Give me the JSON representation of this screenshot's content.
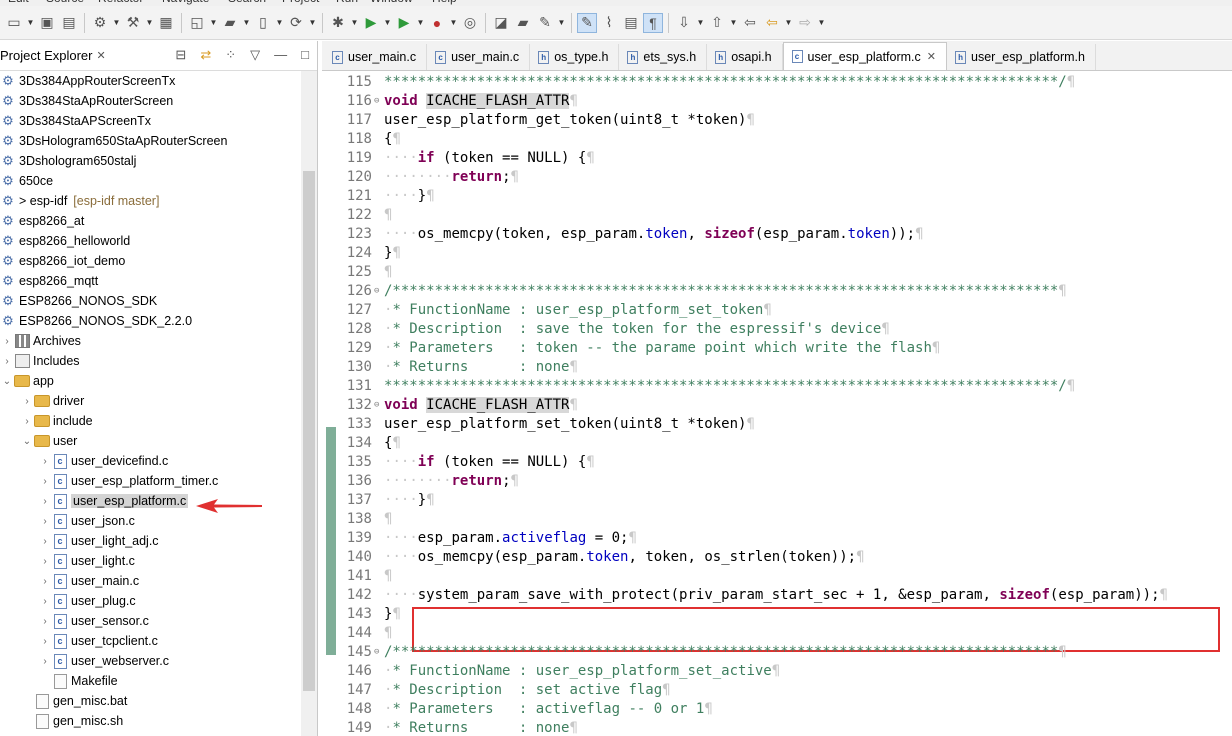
{
  "menubar": [
    "Edit",
    "Source",
    "Refactor",
    "Navigate",
    "Search",
    "Project",
    "Run",
    "Window",
    "Help"
  ],
  "explorer": {
    "title": "Project Explorer",
    "close": "✕",
    "items": [
      {
        "label": "3Ds384AppRouterScreenTx",
        "icon": "project-icon",
        "indent": 0
      },
      {
        "label": "3Ds384StaApRouterScreen",
        "icon": "project-icon",
        "indent": 0
      },
      {
        "label": "3Ds384StaAPScreenTx",
        "icon": "project-icon",
        "indent": 0
      },
      {
        "label": "3DsHologram650StaApRouterScreen",
        "icon": "project-icon",
        "indent": 0
      },
      {
        "label": "3Dshologram650stalj",
        "icon": "project-icon",
        "indent": 0
      },
      {
        "label": "650ce",
        "icon": "project-icon",
        "indent": 0
      },
      {
        "label": "> esp-idf",
        "icon": "project-icon",
        "indent": 0,
        "deco": "[esp-idf master]"
      },
      {
        "label": "esp8266_at",
        "icon": "project-icon",
        "indent": 0
      },
      {
        "label": "esp8266_helloworld",
        "icon": "project-icon",
        "indent": 0
      },
      {
        "label": "esp8266_iot_demo",
        "icon": "project-icon",
        "indent": 0
      },
      {
        "label": "esp8266_mqtt",
        "icon": "project-icon",
        "indent": 0
      },
      {
        "label": "ESP8266_NONOS_SDK",
        "icon": "project-icon",
        "indent": 0
      },
      {
        "label": "ESP8266_NONOS_SDK_2.2.0",
        "icon": "project-icon",
        "indent": 0
      },
      {
        "label": "Archives",
        "icon": "archive-icon",
        "indent": 1,
        "twisty": ">"
      },
      {
        "label": "Includes",
        "icon": "includes-icon",
        "indent": 1,
        "twisty": ">"
      },
      {
        "label": "app",
        "icon": "folder-icon",
        "indent": 1,
        "twisty": "v"
      },
      {
        "label": "driver",
        "icon": "folder-icon",
        "indent": 2,
        "twisty": ">"
      },
      {
        "label": "include",
        "icon": "folder-icon",
        "indent": 2,
        "twisty": ">"
      },
      {
        "label": "user",
        "icon": "folder-icon",
        "indent": 2,
        "twisty": "v"
      },
      {
        "label": "user_devicefind.c",
        "icon": "c-file-icon",
        "indent": 3,
        "twisty": ">"
      },
      {
        "label": "user_esp_platform_timer.c",
        "icon": "c-file-icon",
        "indent": 3,
        "twisty": ">"
      },
      {
        "label": "user_esp_platform.c",
        "icon": "c-file-icon",
        "indent": 3,
        "twisty": ">",
        "selected": true
      },
      {
        "label": "user_json.c",
        "icon": "c-file-icon",
        "indent": 3,
        "twisty": ">"
      },
      {
        "label": "user_light_adj.c",
        "icon": "c-file-icon",
        "indent": 3,
        "twisty": ">"
      },
      {
        "label": "user_light.c",
        "icon": "c-file-icon",
        "indent": 3,
        "twisty": ">"
      },
      {
        "label": "user_main.c",
        "icon": "c-file-icon",
        "indent": 3,
        "twisty": ">"
      },
      {
        "label": "user_plug.c",
        "icon": "c-file-icon",
        "indent": 3,
        "twisty": ">"
      },
      {
        "label": "user_sensor.c",
        "icon": "c-file-icon",
        "indent": 3,
        "twisty": ">"
      },
      {
        "label": "user_tcpclient.c",
        "icon": "c-file-icon",
        "indent": 3,
        "twisty": ">"
      },
      {
        "label": "user_webserver.c",
        "icon": "c-file-icon",
        "indent": 3,
        "twisty": ">"
      },
      {
        "label": "Makefile",
        "icon": "file-icon",
        "indent": 3
      },
      {
        "label": "gen_misc.bat",
        "icon": "script-icon",
        "indent": 2
      },
      {
        "label": "gen_misc.sh",
        "icon": "script-icon",
        "indent": 2
      }
    ]
  },
  "editor": {
    "tabs": [
      {
        "label": "user_main.c",
        "kind": "c"
      },
      {
        "label": "user_main.c",
        "kind": "c"
      },
      {
        "label": "os_type.h",
        "kind": "h"
      },
      {
        "label": "ets_sys.h",
        "kind": "h"
      },
      {
        "label": "osapi.h",
        "kind": "h"
      },
      {
        "label": "user_esp_platform.c",
        "kind": "c",
        "active": true
      },
      {
        "label": "user_esp_platform.h",
        "kind": "h"
      }
    ],
    "tab_close": "✕",
    "lines": [
      {
        "n": "115",
        "t": "********************************************************************************/¶"
      },
      {
        "n": "116",
        "t": "void ICACHE_FLASH_ATTR¶",
        "fold": true
      },
      {
        "n": "117",
        "t": "user_esp_platform_get_token(uint8_t *token)¶"
      },
      {
        "n": "118",
        "t": "{¶"
      },
      {
        "n": "119",
        "t": "····if (token == NULL) {¶"
      },
      {
        "n": "120",
        "t": "········return;¶"
      },
      {
        "n": "121",
        "t": "····}¶"
      },
      {
        "n": "122",
        "t": "¶"
      },
      {
        "n": "123",
        "t": "····os_memcpy(token, esp_param.token, sizeof(esp_param.token));¶"
      },
      {
        "n": "124",
        "t": "}¶"
      },
      {
        "n": "125",
        "t": "¶"
      },
      {
        "n": "126",
        "t": "/*******************************************************************************¶",
        "fold": true
      },
      {
        "n": "127",
        "t": "·* FunctionName : user_esp_platform_set_token¶"
      },
      {
        "n": "128",
        "t": "·* Description  : save the token for the espressif's device¶"
      },
      {
        "n": "129",
        "t": "·* Parameters   : token -- the parame point which write the flash¶"
      },
      {
        "n": "130",
        "t": "·* Returns      : none¶"
      },
      {
        "n": "131",
        "t": "********************************************************************************/¶"
      },
      {
        "n": "132",
        "t": "void ICACHE_FLASH_ATTR¶",
        "fold": true
      },
      {
        "n": "133",
        "t": "user_esp_platform_set_token(uint8_t *token)¶"
      },
      {
        "n": "134",
        "t": "{¶"
      },
      {
        "n": "135",
        "t": "····if (token == NULL) {¶"
      },
      {
        "n": "136",
        "t": "········return;¶"
      },
      {
        "n": "137",
        "t": "····}¶"
      },
      {
        "n": "138",
        "t": "¶"
      },
      {
        "n": "139",
        "t": "····esp_param.activeflag = 0;¶"
      },
      {
        "n": "140",
        "t": "····os_memcpy(esp_param.token, token, os_strlen(token));¶"
      },
      {
        "n": "141",
        "t": "¶"
      },
      {
        "n": "142",
        "t": "····system_param_save_with_protect(priv_param_start_sec + 1, &esp_param, sizeof(esp_param));¶"
      },
      {
        "n": "143",
        "t": "}¶"
      },
      {
        "n": "144",
        "t": "¶"
      },
      {
        "n": "145",
        "t": "/*******************************************************************************¶",
        "fold": true
      },
      {
        "n": "146",
        "t": "·* FunctionName : user_esp_platform_set_active¶"
      },
      {
        "n": "147",
        "t": "·* Description  : set active flag¶"
      },
      {
        "n": "148",
        "t": "·* Parameters   : activeflag -- 0 or 1¶"
      },
      {
        "n": "149",
        "t": "·* Returns      : none¶"
      }
    ]
  },
  "colors": {
    "annotation": "#e03030",
    "keyword": "#7f0055",
    "comment": "#3f7f5f",
    "field": "#0000c0"
  }
}
